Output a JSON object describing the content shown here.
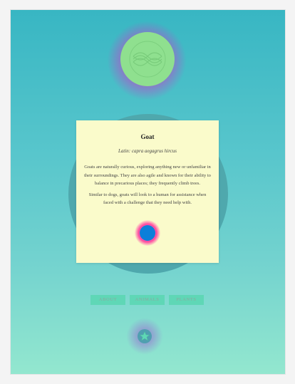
{
  "card": {
    "title": "Goat",
    "latin": "Latin: capra aegagrus hircus",
    "paragraph1": "Goats are naturally curious, exploring anything new or unfamiliar in their surroundings. They are also agile and known for their ability to balance in precarious places; they frequently climb trees.",
    "paragraph2": "Similar to dogs, goats will look to a human for assistance when faced with a challenge that they need help with."
  },
  "nav": {
    "about": "ABOUT",
    "animals": "ANIMALS",
    "plants": "PLANTS"
  },
  "icons": {
    "logo": "knot-logo-icon",
    "card_action": "circle-button-icon",
    "favorite": "star-icon"
  },
  "colors": {
    "bg_top": "#38b6c3",
    "bg_bottom": "#93e7cf",
    "logo": "#8fe08f",
    "card": "#fafbcb",
    "fab": "#0c7fd9",
    "fab_glow": "#ff4fa3",
    "nav_button": "#5fd7b6"
  }
}
